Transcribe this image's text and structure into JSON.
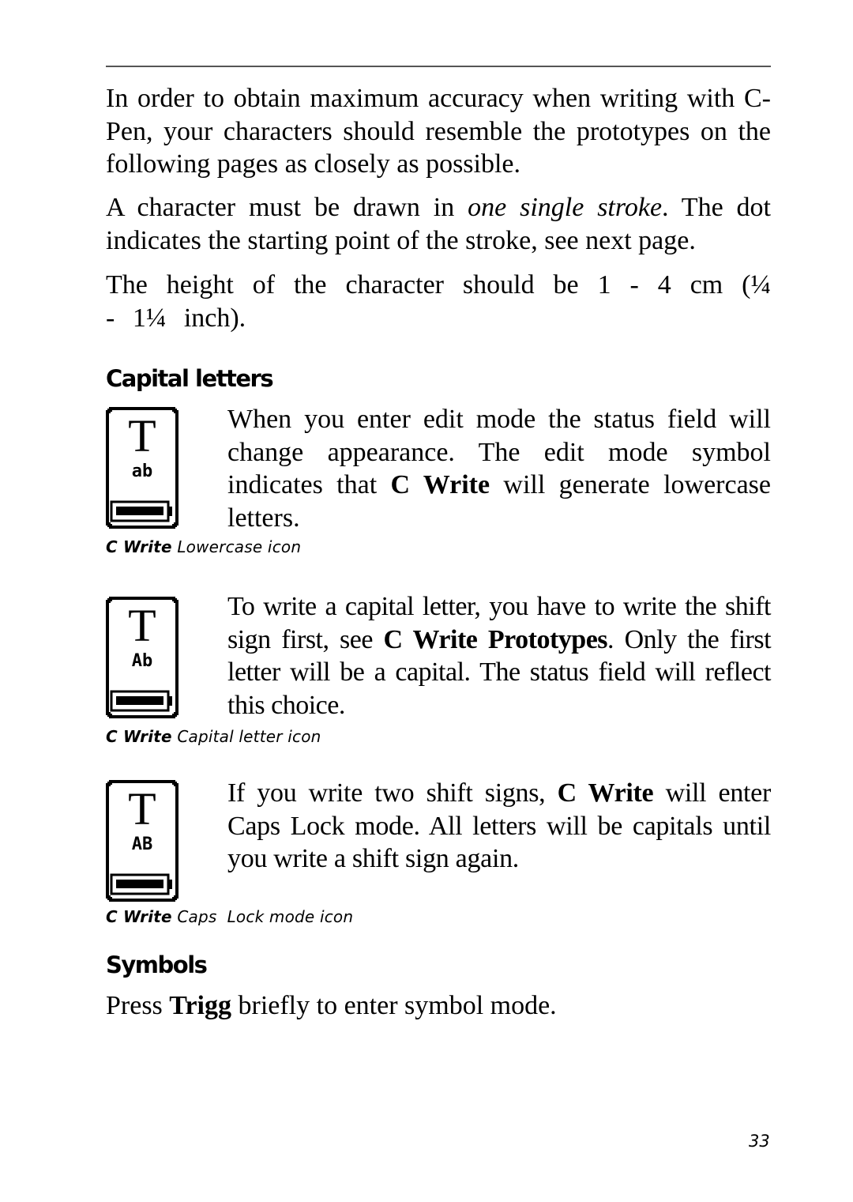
{
  "intro": {
    "p1": "In order to obtain maximum accuracy when writing with C-Pen, your characters should resemble the prototypes on the following pages as closely as possible.",
    "p2_pre": "A character must be drawn in ",
    "p2_em": "one single stroke",
    "p2_post": ". The dot indicates the starting point of the stroke, see next page.",
    "p3": "The height of the character should be 1 - 4 cm (¼ - 1¼ inch)."
  },
  "capital_letters": {
    "heading": "Capital letters",
    "blocks": [
      {
        "icon": "c-write-lowercase-icon",
        "icon_glyph_top": "T",
        "icon_glyph_mode": "ab",
        "text_pre": "When you enter edit mode the status field will change appearance. The edit mode symbol indicates that ",
        "text_bold": "C Write",
        "text_post": " will generate lowercase letters.",
        "caption_bold": "C Write",
        "caption_rest": " Lowercase icon"
      },
      {
        "icon": "c-write-capital-letter-icon",
        "icon_glyph_top": "T",
        "icon_glyph_mode": "Ab",
        "text_pre": "To write a capital letter, you have to write the shift sign first, see ",
        "text_bold": "C Write Prototypes",
        "text_post": ". Only the first letter will be a capital. The status field will reflect this choice.",
        "caption_bold": "C Write",
        "caption_rest": " Capital letter icon"
      },
      {
        "icon": "c-write-caps-lock-mode-icon",
        "icon_glyph_top": "T",
        "icon_glyph_mode": "AB",
        "text_pre": "If you write two shift signs, ",
        "text_bold": "C Write",
        "text_post": " will enter Caps Lock mode. All letters will be capitals until you write a shift sign again.",
        "caption_bold": "C Write",
        "caption_rest": " Caps  Lock mode icon"
      }
    ]
  },
  "symbols": {
    "heading": "Symbols",
    "text_pre": "Press ",
    "text_bold": "Trigg",
    "text_post": " briefly to enter symbol mode."
  },
  "page_number": "33"
}
